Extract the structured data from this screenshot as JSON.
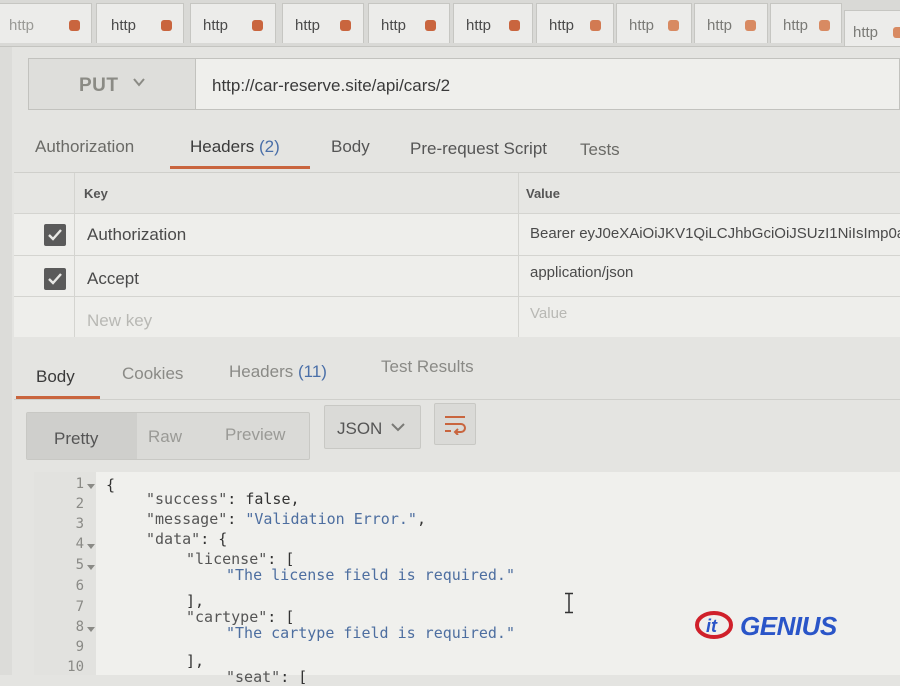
{
  "request_tabs_strip": [
    {
      "label": "http",
      "dot_color": "#c9653e"
    },
    {
      "label": "http",
      "dot_color": "#c9653e"
    },
    {
      "label": "http",
      "dot_color": "#c9653e"
    },
    {
      "label": "http",
      "dot_color": "#c9653e"
    },
    {
      "label": "http",
      "dot_color": "#c9653e"
    },
    {
      "label": "http",
      "dot_color": "#c9653e"
    },
    {
      "label": "http",
      "dot_color": "#c9653e"
    },
    {
      "label": "http",
      "dot_color": "#d88a62"
    },
    {
      "label": "http",
      "dot_color": "#d88a62"
    },
    {
      "label": "http",
      "dot_color": "#d88a62"
    },
    {
      "label": "http",
      "dot_color": "#d88a62"
    }
  ],
  "request": {
    "method": "PUT",
    "url": "http://car-reserve.site/api/cars/2"
  },
  "request_tabs": {
    "authorization": "Authorization",
    "headers": "Headers",
    "headers_count": "(2)",
    "body": "Body",
    "prerequest": "Pre-request Script",
    "tests": "Tests"
  },
  "headers_table": {
    "col_key": "Key",
    "col_value": "Value",
    "rows": [
      {
        "key": "Authorization",
        "value": "Bearer eyJ0eXAiOiJKV1QiLCJhbGciOiJSUzI1NiIsImp0a...",
        "checked": true
      },
      {
        "key": "Accept",
        "value": "application/json",
        "checked": true
      }
    ],
    "new_key_placeholder": "New key",
    "value_placeholder": "Value"
  },
  "response_tabs": {
    "body": "Body",
    "cookies": "Cookies",
    "headers": "Headers",
    "headers_count": "(11)",
    "test_results": "Test Results"
  },
  "toolbar": {
    "pretty": "Pretty",
    "raw": "Raw",
    "preview": "Preview",
    "language": "JSON",
    "wrap_icon": "wrap-lines-icon"
  },
  "code": {
    "line_numbers": [
      "1",
      "2",
      "3",
      "4",
      "5",
      "6",
      "7",
      "8",
      "9",
      "10"
    ],
    "l1": "{",
    "l2_key": "\"success\"",
    "l2_rest": ": false,",
    "l3_key": "\"message\"",
    "l3_sep": ": ",
    "l3_val": "\"Validation Error.\"",
    "l3_end": ",",
    "l4_key": "\"data\"",
    "l4_rest": ": {",
    "l5_key": "\"license\"",
    "l5_rest": ": [",
    "l6_val": "\"The license field is required.\"",
    "l7": "],",
    "l8_key": "\"cartype\"",
    "l8_rest": ": [",
    "l9_val": "\"The cartype field is required.\"",
    "l10": "],",
    "l11_key": "\"seat\"",
    "l11_rest": ": ["
  },
  "watermark": {
    "logo_text": "GENIUS"
  },
  "colors": {
    "accent": "#c9653e",
    "count_blue": "#4a6fa8",
    "string_blue": "#4d6ea0",
    "logo_blue": "#2a55c8",
    "logo_red": "#d0202a"
  }
}
